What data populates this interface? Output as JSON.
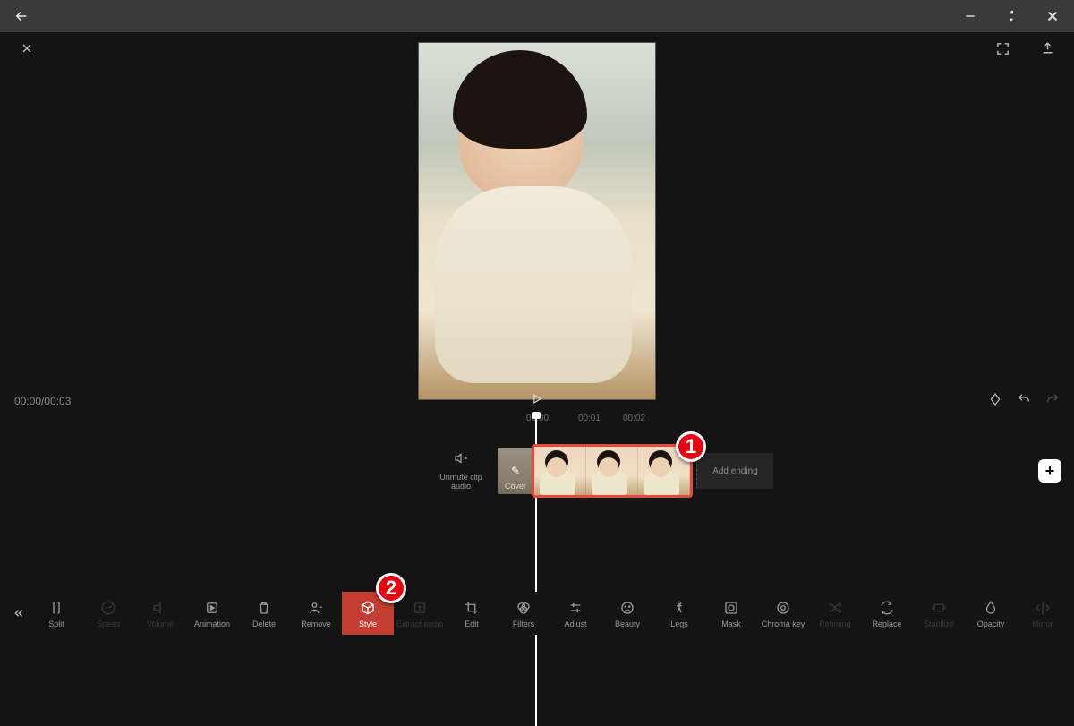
{
  "timecode": "00:00/00:03",
  "ruler": {
    "t0": "00:00",
    "t1": "00:01",
    "t2": "00:02"
  },
  "timeline": {
    "unmute_label": "Unmute clip audio",
    "cover_label": "Cover",
    "add_ending_label": "Add ending"
  },
  "markers": {
    "one": "1",
    "two": "2"
  },
  "toolbar": {
    "split": "Split",
    "speed": "Speed",
    "volume": "Volume",
    "animation": "Animation",
    "delete": "Delete",
    "remove": "Remove",
    "style": "Style",
    "extract_audio": "Extract audio",
    "edit": "Edit",
    "filters": "Filters",
    "adjust": "Adjust",
    "beauty": "Beauty",
    "legs": "Legs",
    "mask": "Mask",
    "chroma_key": "Chroma key",
    "retiming": "Retiming",
    "replace": "Replace",
    "stabilize": "Stabilize",
    "opacity": "Opacity",
    "mirror": "Mirror"
  }
}
